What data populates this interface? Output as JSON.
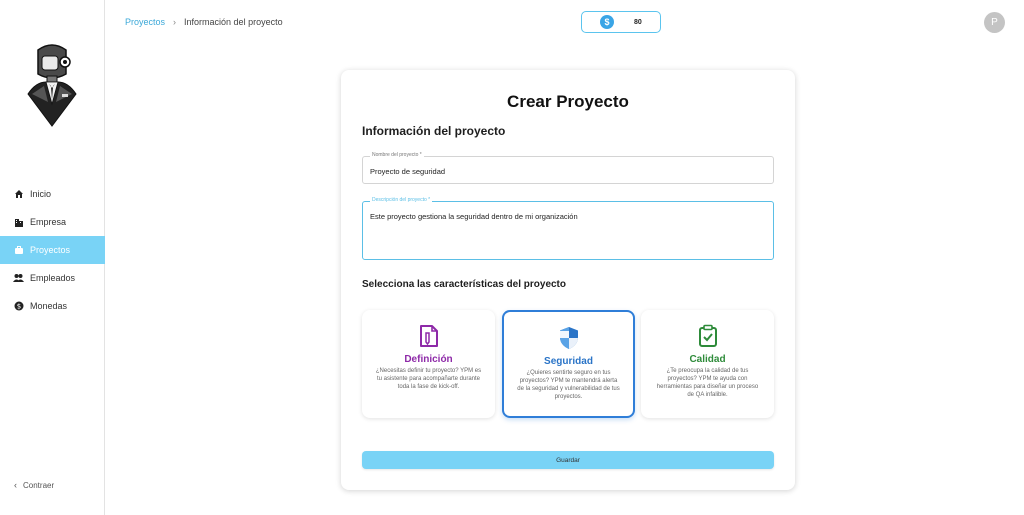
{
  "sidebar": {
    "items": [
      {
        "label": "Inicio",
        "icon": "home-icon"
      },
      {
        "label": "Empresa",
        "icon": "building-icon"
      },
      {
        "label": "Proyectos",
        "icon": "briefcase-icon",
        "active": true
      },
      {
        "label": "Empleados",
        "icon": "people-icon"
      },
      {
        "label": "Monedas",
        "icon": "coin-icon"
      }
    ],
    "collapse_label": "Contraer"
  },
  "header": {
    "breadcrumb": {
      "parent": "Proyectos",
      "current": "Información del proyecto"
    },
    "coins": "80",
    "avatar_initial": "P"
  },
  "form": {
    "title": "Crear Proyecto",
    "info_title": "Información del proyecto",
    "name_label": "Nombre del proyecto *",
    "name_value": "Proyecto de seguridad",
    "desc_label": "Descripción del proyecto *",
    "desc_value": "Este proyecto gestiona la seguridad dentro de mi organización",
    "features_title": "Selecciona las características del proyecto",
    "options": [
      {
        "name": "Definición",
        "desc": "¿Necesitas definir tu proyecto? YPM es tu asistente para acompañarte durante toda la fase de kick-off.",
        "color": "#8e2aa8",
        "icon": "document-pen-icon"
      },
      {
        "name": "Seguridad",
        "desc": "¿Quieres sentirte seguro en tus proyectos? YPM te mantendrá alerta de la seguridad y vulnerabilidad de tus proyectos.",
        "color": "#2a74c7",
        "icon": "shield-icon",
        "selected": true
      },
      {
        "name": "Calidad",
        "desc": "¿Te preocupa la calidad de tus proyectos? YPM te ayuda con herramientas para diseñar un proceso de QA infalible.",
        "color": "#2e8b3a",
        "icon": "clipboard-check-icon"
      }
    ],
    "save_label": "Guardar"
  },
  "colors": {
    "accent": "#79d3f6",
    "link": "#3ba8d8",
    "selected_border": "#2f7ed8"
  }
}
